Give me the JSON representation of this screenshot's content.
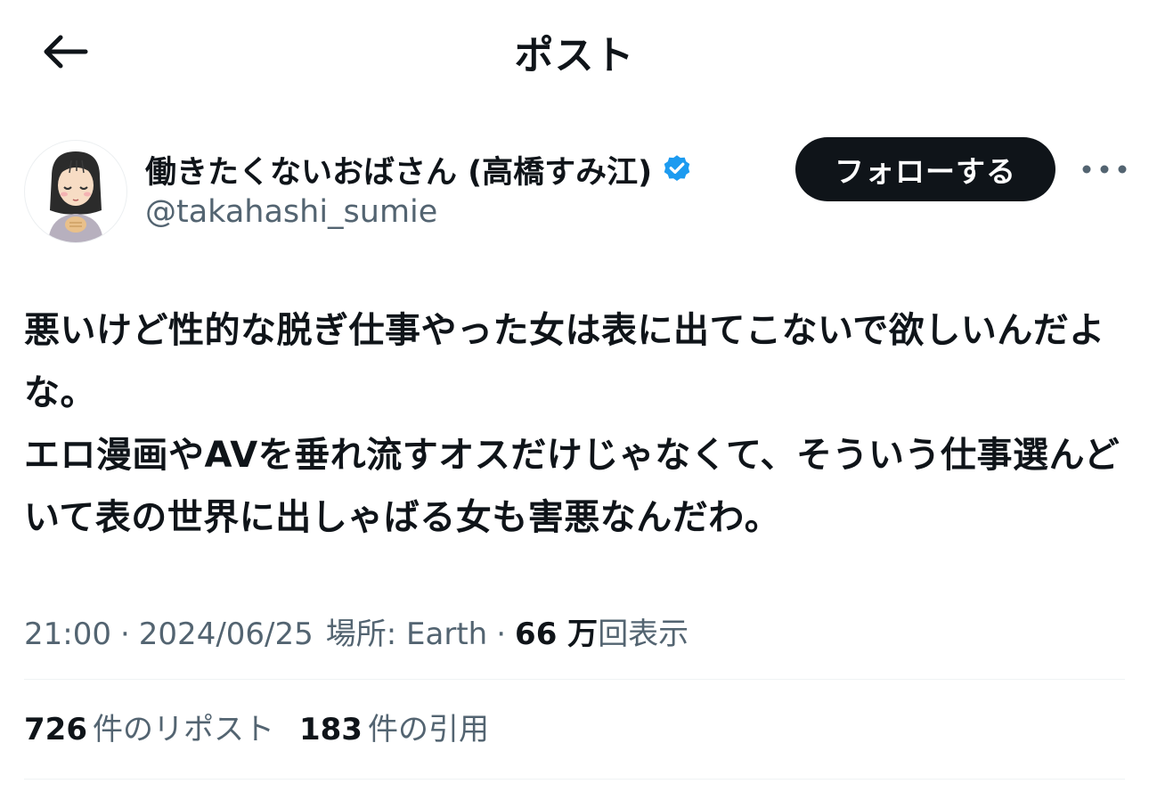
{
  "header": {
    "title": "ポスト",
    "back_icon": "arrow-left-icon"
  },
  "author": {
    "display_name": "働きたくないおばさん (高橋すみ江)",
    "handle": "@takahashi_sumie",
    "verified": true,
    "verified_color": "#1d9bf0",
    "follow_label": "フォローする",
    "more_icon": "more-horizontal-icon"
  },
  "post": {
    "text": "悪いけど性的な脱ぎ仕事やった女は表に出てこないで欲しいんだよな。\nエロ漫画やAVを垂れ流すオスだけじゃなくて、そういう仕事選んどいて表の世界に出しゃばる女も害悪なんだわ。"
  },
  "meta": {
    "time": "21:00",
    "date": "2024/06/25",
    "location": "場所: Earth",
    "views_number": "66 万",
    "views_label": "回表示"
  },
  "stats": {
    "reposts_count": "726",
    "reposts_label": "件のリポスト",
    "quotes_count": "183",
    "quotes_label": "件の引用"
  },
  "colors": {
    "text_primary": "#0f1419",
    "text_secondary": "#536471",
    "button_bg": "#0f1419",
    "divider": "#eff3f4"
  }
}
